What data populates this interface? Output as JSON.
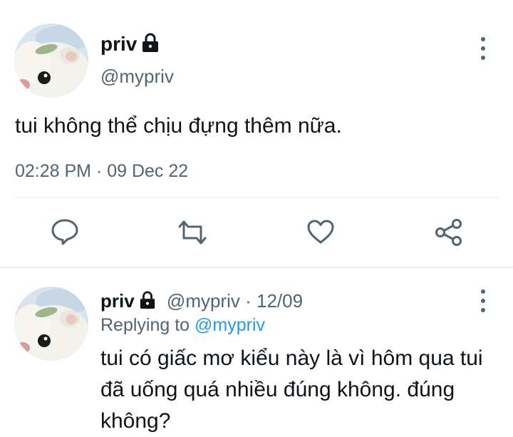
{
  "tweet": {
    "author_name": "priv",
    "author_handle": "@mypriv",
    "text": "tui không thể chịu đựng thêm nữa.",
    "timestamp": "02:28 PM · 09 Dec 22",
    "protected_icon": "lock-icon",
    "more_icon": "more-vertical-icon"
  },
  "actions": [
    {
      "name": "reply",
      "icon": "comment-icon"
    },
    {
      "name": "retweet",
      "icon": "retweet-icon"
    },
    {
      "name": "like",
      "icon": "heart-icon"
    },
    {
      "name": "share",
      "icon": "share-icon"
    }
  ],
  "reply": {
    "author_name": "priv",
    "author_handle": "@mypriv",
    "separator": "·",
    "date": "12/09",
    "replying_prefix": "Replying to",
    "replying_mention": "@mypriv",
    "text": "tui có giấc mơ kiểu này là vì hôm qua tui đã uống quá nhiều đúng không. đúng không?"
  },
  "colors": {
    "text": "#0f1419",
    "secondary": "#536471",
    "accent": "#1d9bf0"
  }
}
